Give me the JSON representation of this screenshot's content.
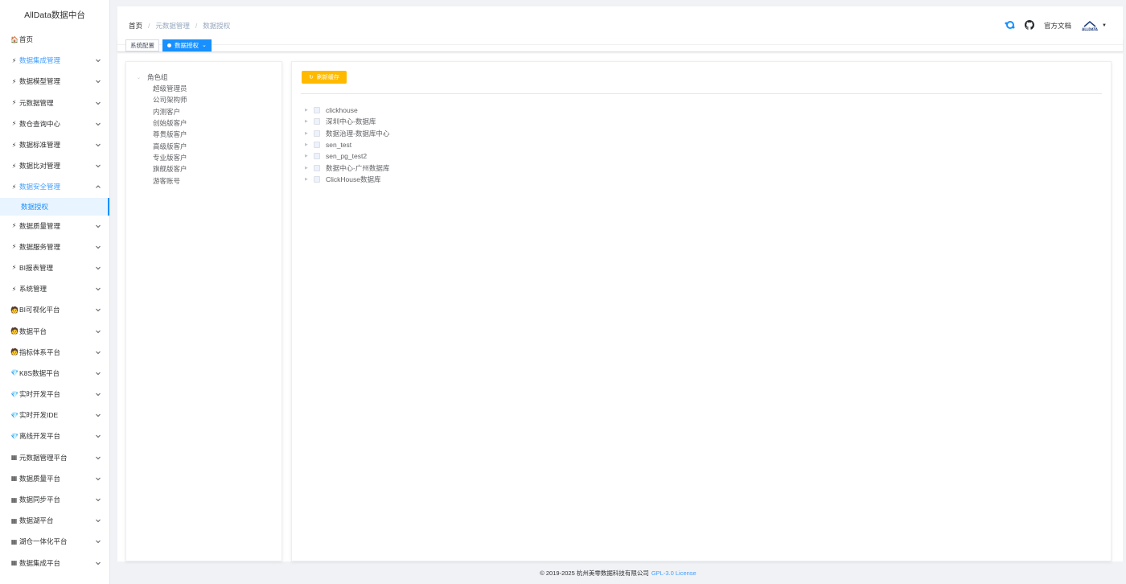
{
  "app": {
    "title": "AllData数据中台"
  },
  "sidebar": {
    "home": {
      "label": "首页",
      "icon": "🏠"
    },
    "items": [
      {
        "label": "数据集成管理",
        "icon": "⚡",
        "active": true
      },
      {
        "label": "数据模型管理",
        "icon": "⚡"
      },
      {
        "label": "元数据管理",
        "icon": "⚡"
      },
      {
        "label": "数仓查询中心",
        "icon": "⚡"
      },
      {
        "label": "数据标准管理",
        "icon": "⚡"
      },
      {
        "label": "数据比对管理",
        "icon": "⚡"
      },
      {
        "label": "数据安全管理",
        "icon": "⚡",
        "active": true,
        "open": true,
        "children": [
          "数据授权"
        ]
      },
      {
        "label": "数据质量管理",
        "icon": "⚡"
      },
      {
        "label": "数据服务管理",
        "icon": "⚡"
      },
      {
        "label": "BI报表管理",
        "icon": "⚡"
      },
      {
        "label": "系统管理",
        "icon": "⚡"
      },
      {
        "label": "BI可视化平台",
        "icon": "🧑"
      },
      {
        "label": "数据平台",
        "icon": "🧑"
      },
      {
        "label": "指标体系平台",
        "icon": "🧑"
      },
      {
        "label": "K8S数据平台",
        "icon": "💎"
      },
      {
        "label": "实时开发平台",
        "icon": "💎"
      },
      {
        "label": "实时开发IDE",
        "icon": "💎"
      },
      {
        "label": "离线开发平台",
        "icon": "💎"
      },
      {
        "label": "元数据管理平台",
        "icon": "▦"
      },
      {
        "label": "数据质量平台",
        "icon": "▦"
      },
      {
        "label": "数据同步平台",
        "icon": "▦"
      },
      {
        "label": "数据湖平台",
        "icon": "▦"
      },
      {
        "label": "湖仓一体化平台",
        "icon": "▦"
      },
      {
        "label": "数据集成平台",
        "icon": "▦"
      }
    ]
  },
  "navbar": {
    "breadcrumb": [
      "首页",
      "元数据管理",
      "数据授权"
    ],
    "doc_link": "官方文档",
    "avatar_text": "ALLDATA"
  },
  "tags": [
    {
      "label": "系统配置",
      "active": false
    },
    {
      "label": "数据授权",
      "active": true
    }
  ],
  "left_tree": {
    "root": "角色组",
    "children": [
      "超级管理员",
      "公司架构师",
      "内测客户",
      "创始版客户",
      "尊贵版客户",
      "高级版客户",
      "专业版客户",
      "旗舰版客户",
      "游客账号"
    ]
  },
  "right": {
    "refresh_label": "刷新缓存",
    "databases": [
      "clickhouse",
      "深圳中心-数据库",
      "数据治理-数据库中心",
      "sen_test",
      "sen_pg_test2",
      "数据中心-广州数据库",
      "ClickHouse数据库"
    ]
  },
  "footer": {
    "copyright": "© 2019-2025 杭州美零数据科技有限公司",
    "license": "GPL-3.0 License"
  },
  "colors": {
    "primary": "#1890ff",
    "warning": "#ffba00"
  }
}
